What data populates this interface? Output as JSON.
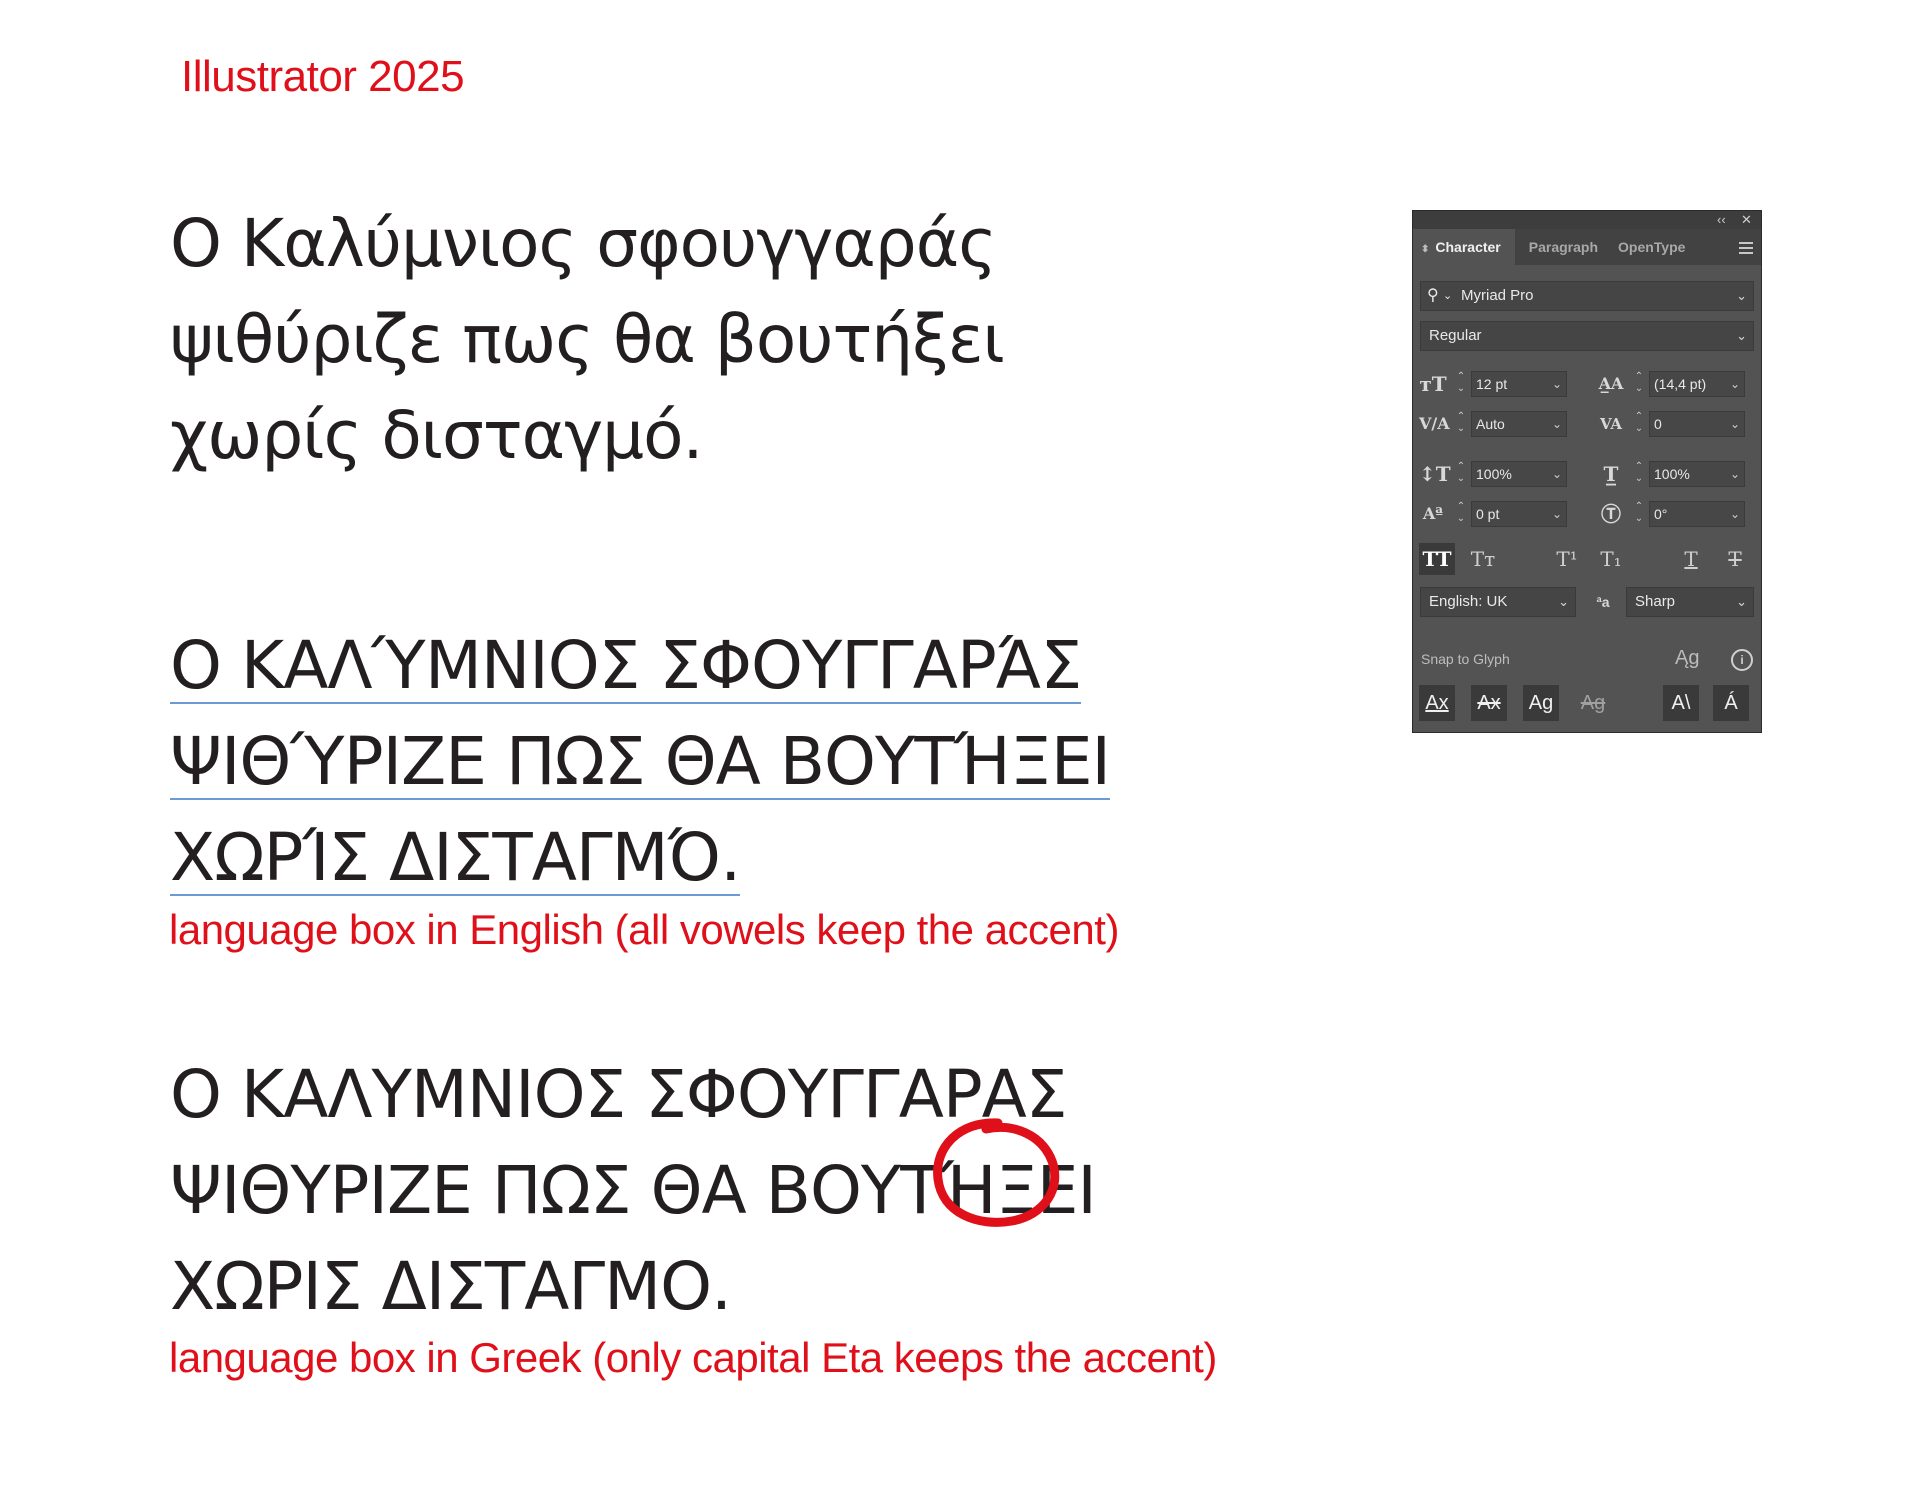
{
  "heading": "Illustrator 2025",
  "block1": {
    "lines": [
      "Ο Καλύμνιος σφουγγαράς",
      "ψιθύριζε πως θα βουτήξει",
      "χωρίς δισταγμό."
    ]
  },
  "block2": {
    "lines": [
      "Ο ΚΑΛΎΜΝΙΟΣ ΣΦΟΥΓΓΑΡΆΣ",
      "ΨΙΘΎΡΙΖΕ ΠΩΣ ΘΑ ΒΟΥΤΉΞΕΙ",
      "ΧΩΡΊΣ ΔΙΣΤΑΓΜΌ."
    ],
    "caption": "language box in English (all vowels keep the accent)"
  },
  "block3": {
    "lines": [
      "Ο ΚΑΛΥΜΝΙΟΣ ΣΦΟΥΓΓΑΡΑΣ",
      "ΨΙΘΥΡΙΖΕ ΠΩΣ ΘΑ ΒΟΥΤΉΞΕΙ",
      "ΧΩΡΙΣ ΔΙΣΤΑΓΜΟ."
    ],
    "caption": "language box in Greek (only capital Eta keeps the accent)"
  },
  "colors": {
    "accent_red": "#e0101a",
    "panel_bg": "#535353",
    "underline_blue": "#6d9ad4"
  },
  "panel": {
    "collapse_glyph": "‹‹",
    "close_glyph": "✕",
    "tabs": [
      "Character",
      "Paragraph",
      "OpenType"
    ],
    "font_family": "Myriad Pro",
    "font_style": "Regular",
    "font_size": "12 pt",
    "leading": "(14,4 pt)",
    "kerning": "Auto",
    "tracking": "0",
    "vertical_scale": "100%",
    "horizontal_scale": "100%",
    "baseline_shift": "0 pt",
    "rotation": "0°",
    "language": "English: UK",
    "antialiasing": "Sharp",
    "snap_to_glyph": "Snap to Glyph",
    "icons": {
      "search": "search-icon",
      "menu": "panel-menu-icon",
      "info": "info-icon"
    }
  }
}
